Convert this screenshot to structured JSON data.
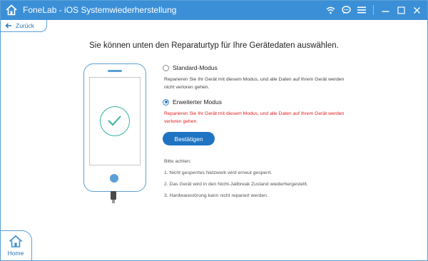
{
  "titlebar": {
    "title": "FoneLab - iOS Systemwiederherstellung",
    "controls": [
      "wifi-icon",
      "feedback-icon",
      "menu-icon",
      "minimize-icon",
      "maximize-icon",
      "close-icon"
    ]
  },
  "nav": {
    "back_label": "Zurück",
    "home_label": "Home"
  },
  "main": {
    "heading": "Sie können unten den Reparaturtyp für Ihre Gerätedaten auswählen.",
    "options": [
      {
        "label": "Standard-Modus",
        "selected": false,
        "description_line1": "Reparieren Sie Ihr Gerät mit diesem Modus, und alle Daten auf Ihrem Gerät werden",
        "description_line2": "nicht verloren gehen."
      },
      {
        "label": "Erweiterter Modus",
        "selected": true,
        "description_line1": "Reparieren Sie Ihr Gerät mit diesem Modus, und alle Daten auf Ihrem Gerät werden",
        "description_line2": "verloren gehen."
      }
    ],
    "confirm_label": "Bestätigen",
    "notes_title": "Bitte achten:",
    "notes": [
      "1. Nicht gesperrtes Netzwerk wird erneut gesperrt.",
      "2. Das Gerät wird in den Nicht-Jailbreak Zustand wiederhergestellt.",
      "3. Hardwarestörung kann nicht repariert werden."
    ]
  },
  "colors": {
    "accent": "#3b8fd6",
    "button": "#1e73c2",
    "warning": "#e0201f",
    "check": "#38b3a0"
  }
}
